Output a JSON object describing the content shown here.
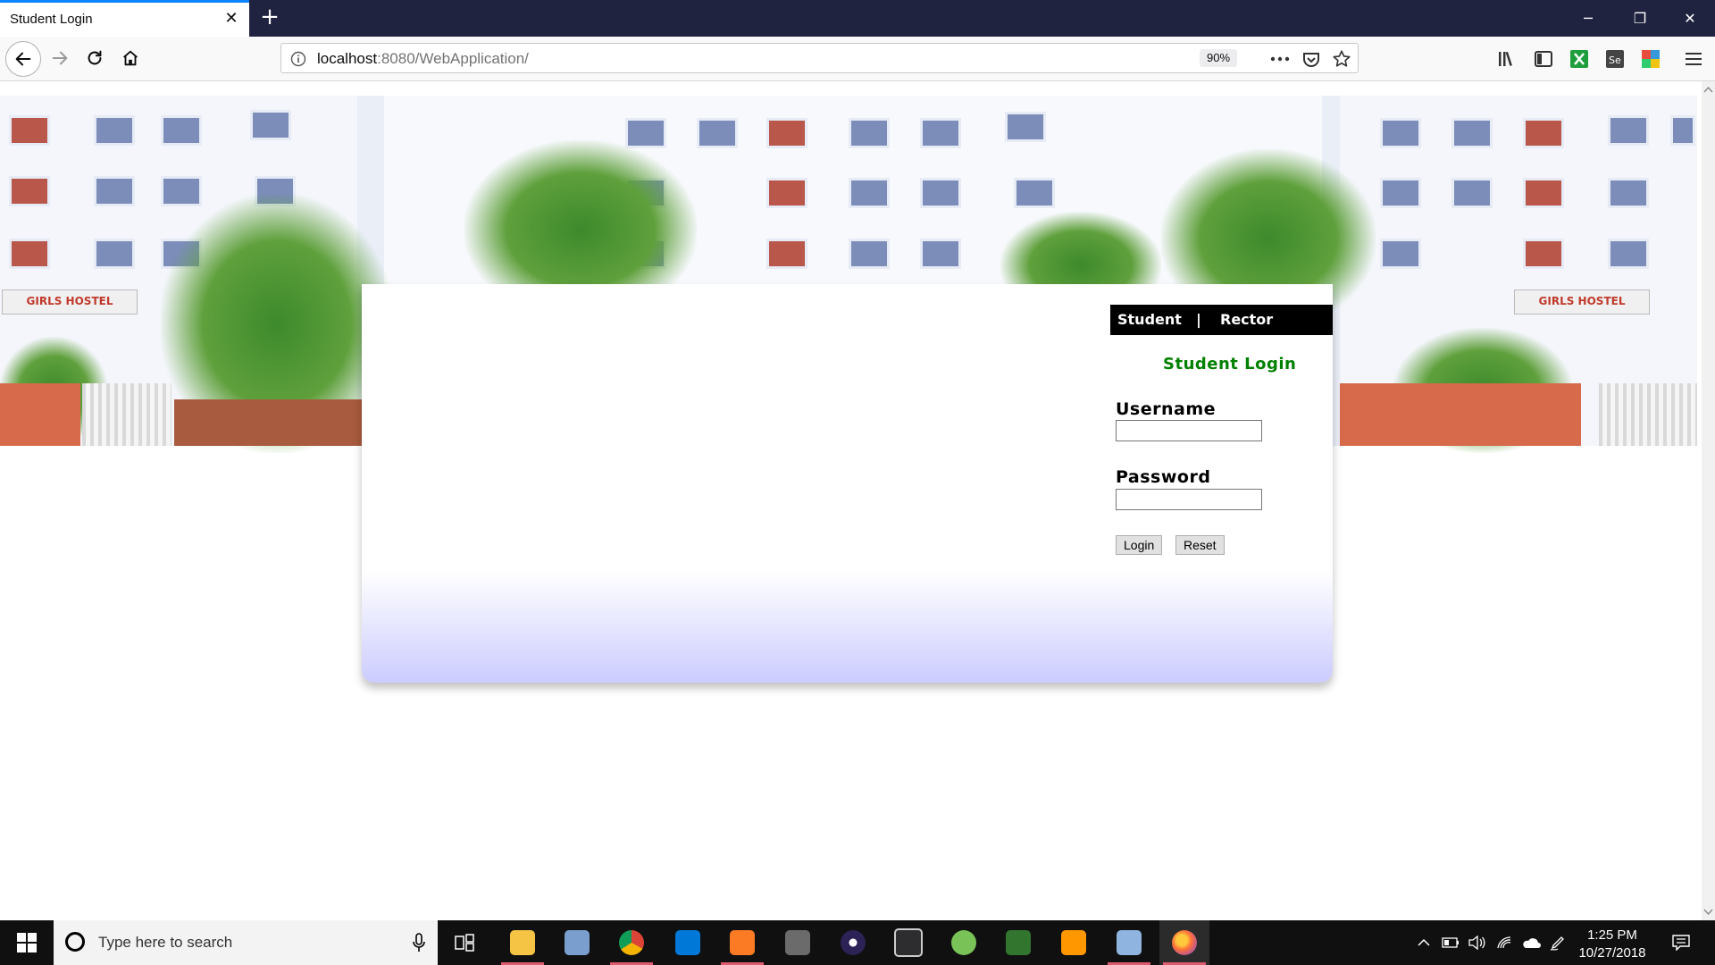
{
  "browser": {
    "tab_title": "Student Login",
    "tab_close": "✕",
    "new_tab": "+",
    "url_host": "localhost",
    "url_rest": ":8080/WebApplication/",
    "zoom": "90%",
    "window_controls": [
      "─",
      "❐",
      "✕"
    ]
  },
  "page": {
    "banner_sign": "GIRLS HOSTEL",
    "roles": {
      "student": "Student",
      "separator": "|",
      "rector": "Rector"
    },
    "login_heading": "Student Login",
    "username_label": "Username",
    "password_label": "Password",
    "username_value": "",
    "password_value": "",
    "login_button": "Login",
    "reset_button": "Reset",
    "colors": {
      "heading": "#008000",
      "panel_gradient_end": "#ccccff",
      "role_bar": "#000000"
    }
  },
  "taskbar": {
    "search_placeholder": "Type here to search",
    "apps": [
      "task-view",
      "file-explorer",
      "device-manager",
      "chrome",
      "skype-for-business",
      "xampp",
      "snipping-tool",
      "eclipse",
      "visual-studio",
      "android-studio",
      "ms-project",
      "sublime-text",
      "virtualbox",
      "firefox"
    ],
    "time": "1:25 PM",
    "date": "10/27/2018"
  }
}
